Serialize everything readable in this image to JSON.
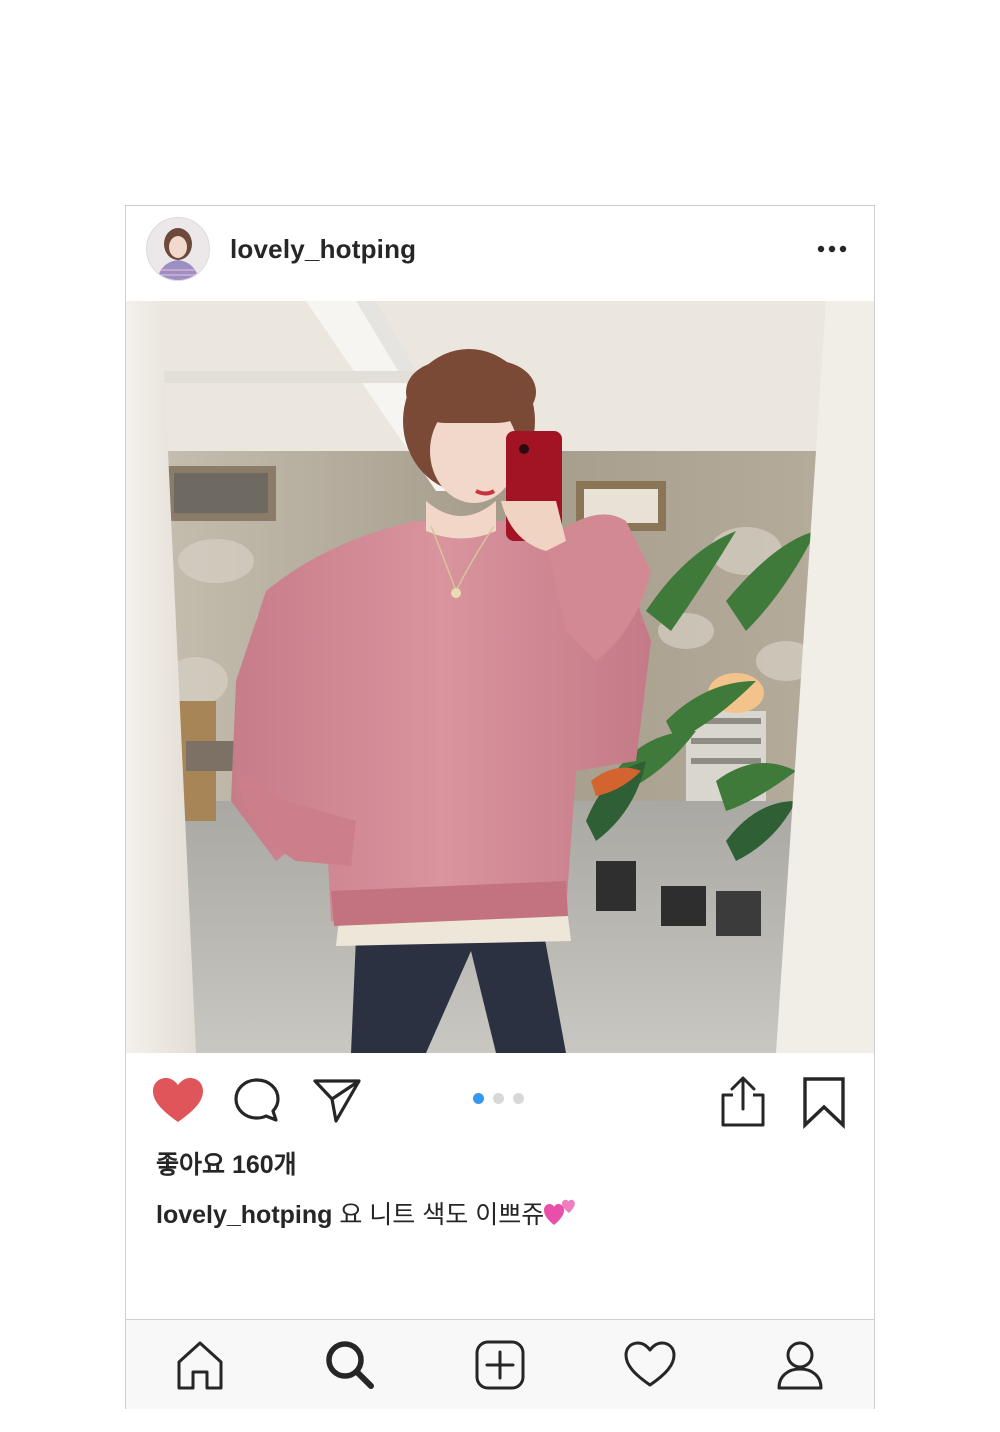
{
  "post": {
    "username": "lovely_hotping",
    "photo_alt": "",
    "carousel": {
      "count": 3,
      "active_index": 0
    }
  },
  "actions": {
    "liked": true
  },
  "likes_text": "좋아요 160개",
  "caption": {
    "username": "lovely_hotping",
    "text": " 요 니트 색도 이쁘쥬",
    "emoji": "two-hearts-icon"
  },
  "tabbar": {
    "tabs": [
      "home",
      "search",
      "new-post",
      "activity",
      "profile"
    ],
    "active": "search"
  },
  "colors": {
    "heart": "#e0555a",
    "carousel_active": "#3897f0",
    "carousel_inactive": "#d8d8d8",
    "text": "#262626",
    "tabbar_bg": "#f8f8f8",
    "border": "#cfcfcf",
    "sweater": "#d48c96"
  }
}
